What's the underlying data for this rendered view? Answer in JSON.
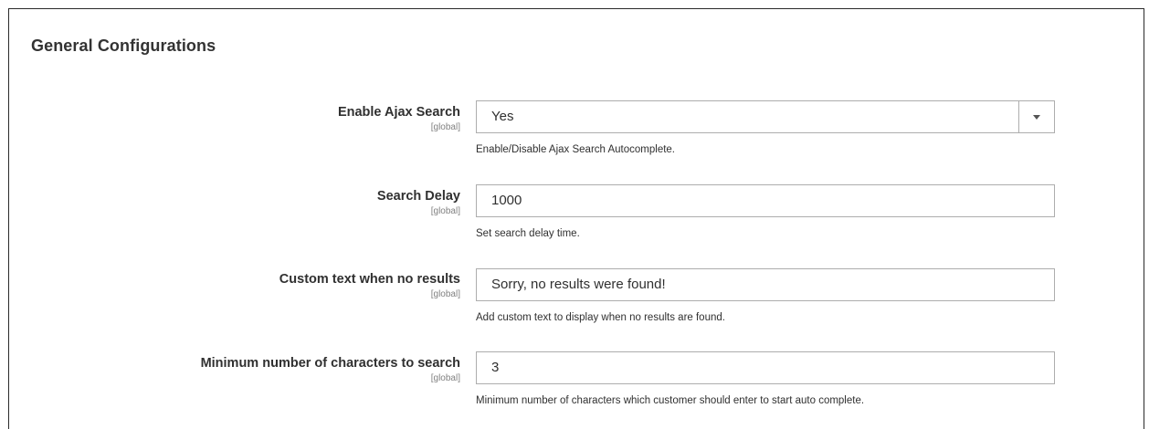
{
  "section": {
    "title": "General Configurations"
  },
  "fields": [
    {
      "label": "Enable Ajax Search",
      "scope": "[global]",
      "type": "select",
      "value": "Yes",
      "note": "Enable/Disable Ajax Search Autocomplete."
    },
    {
      "label": "Search Delay",
      "scope": "[global]",
      "type": "text",
      "value": "1000",
      "note": "Set search delay time."
    },
    {
      "label": "Custom text when no results",
      "scope": "[global]",
      "type": "text",
      "value": "Sorry, no results were found!",
      "note": "Add custom text to display when no results are found."
    },
    {
      "label": "Minimum number of characters to search",
      "scope": "[global]",
      "type": "text",
      "value": "3",
      "note": "Minimum number of characters which customer should enter to start auto complete."
    }
  ],
  "icons": {
    "select_arrow": "chevron-down-icon"
  }
}
